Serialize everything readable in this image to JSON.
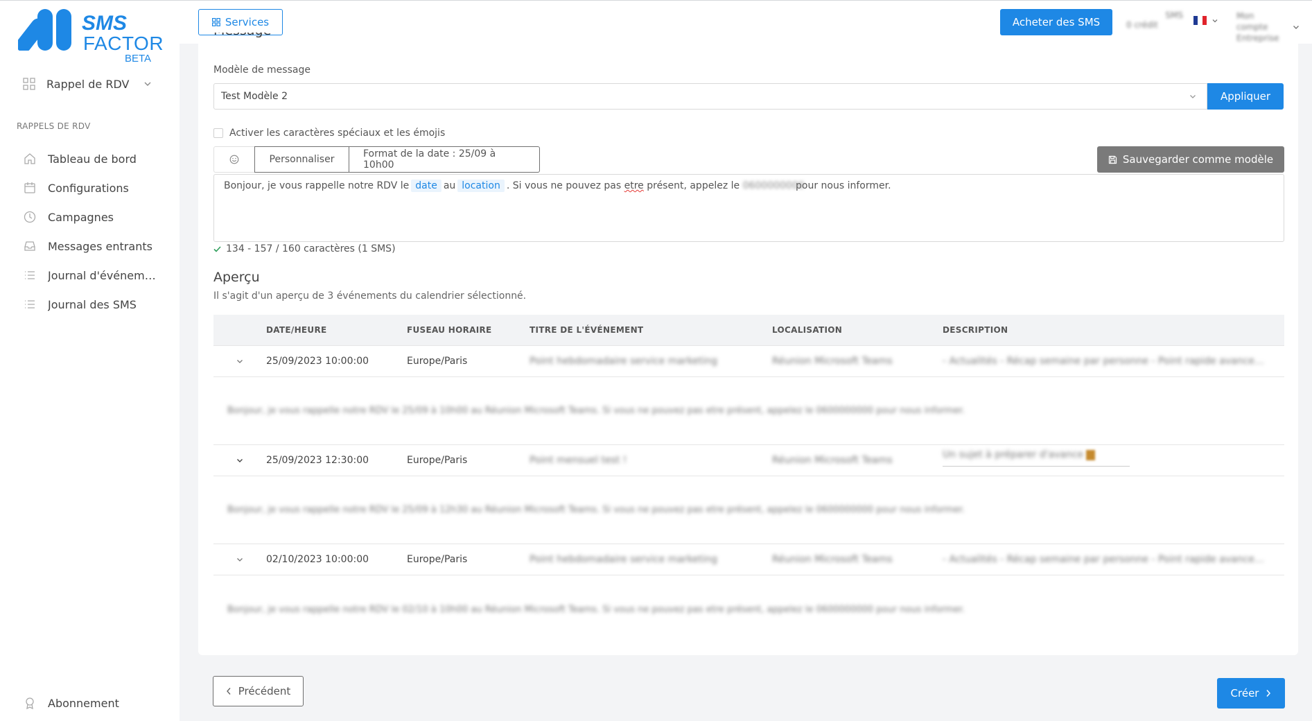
{
  "brand": {
    "line1": "SMS",
    "line2": "FACTOR",
    "tag": "BETA",
    "color": "#1e88e5"
  },
  "sidebar": {
    "module": "Rappel de RDV",
    "section_title": "RAPPELS DE RDV",
    "items": [
      {
        "label": "Tableau de bord",
        "icon": "home-icon"
      },
      {
        "label": "Configurations",
        "icon": "calendar-icon"
      },
      {
        "label": "Campagnes",
        "icon": "clock-icon"
      },
      {
        "label": "Messages entrants",
        "icon": "inbox-icon"
      },
      {
        "label": "Journal d'événements",
        "icon": "list-icon"
      },
      {
        "label": "Journal des SMS",
        "icon": "list-icon"
      }
    ],
    "bottom_item": {
      "label": "Abonnement",
      "icon": "award-icon"
    }
  },
  "header": {
    "services_label": "Services",
    "buy_label": "Acheter des SMS",
    "credits_line1": "SMS",
    "credits_line2": "0 crédit",
    "user_line1": "Mon compte",
    "user_line2": "Entreprise",
    "language_flag": "fr"
  },
  "form": {
    "section_heading": "Message",
    "template_label": "Modèle de message",
    "template_value": "Test Modèle 2",
    "apply_label": "Appliquer",
    "special_chars_label": "Activer les caractères spéciaux et les émojis",
    "personalize_label": "Personnaliser",
    "date_format_label": "Format de la date : 25/09 à 10h00",
    "save_template_label": "Sauvegarder comme modèle",
    "message": {
      "part1": "Bonjour, je vous rappelle notre RDV le",
      "tag_date": "date",
      "part2": "au",
      "tag_location": "location",
      "part3": ". Si vous ne pouvez pas ",
      "misspelled": "etre",
      "part4": " présent, appelez le ",
      "phone": "0600000000",
      "part5": " pour nous informer."
    },
    "counter": "134 - 157 / 160 caractères (1 SMS)"
  },
  "preview": {
    "title": "Aperçu",
    "subtitle": "Il s'agit d'un aperçu de 3 événements du calendrier sélectionné.",
    "columns": [
      "DATE/HEURE",
      "FUSEAU HORAIRE",
      "TITRE DE L'ÉVÉNEMENT",
      "LOCALISATION",
      "DESCRIPTION"
    ],
    "rows": [
      {
        "date": "25/09/2023 10:00:00",
        "tz": "Europe/Paris",
        "title": "Point hebdomadaire service marketing",
        "location": "Réunion Microsoft Teams",
        "description": "- Actualités - Récap semaine par personne - Point rapide avancement",
        "message": "Bonjour, je vous rappelle notre RDV le 25/09 à 10h00 au Réunion Microsoft Teams. Si vous ne pouvez pas etre présent, appelez le 0600000000 pour nous informer."
      },
      {
        "date": "25/09/2023 12:30:00",
        "tz": "Europe/Paris",
        "title": "Point mensuel test !",
        "location": "Réunion Microsoft Teams",
        "description": "Un sujet à préparer d'avance",
        "message": "Bonjour, je vous rappelle notre RDV le 25/09 à 12h30 au Réunion Microsoft Teams. Si vous ne pouvez pas etre présent, appelez le 0600000000 pour nous informer."
      },
      {
        "date": "02/10/2023 10:00:00",
        "tz": "Europe/Paris",
        "title": "Point hebdomadaire service marketing",
        "location": "Réunion Microsoft Teams",
        "description": "- Actualités - Récap semaine par personne - Point rapide avancement",
        "message": "Bonjour, je vous rappelle notre RDV le 02/10 à 10h00 au Réunion Microsoft Teams. Si vous ne pouvez pas etre présent, appelez le 0600000000 pour nous informer."
      }
    ]
  },
  "footer": {
    "prev_label": "Précédent",
    "create_label": "Créer"
  },
  "colors": {
    "accent": "#1e88e5",
    "save_button": "#7a7a7a",
    "check": "#2e9e5b"
  }
}
